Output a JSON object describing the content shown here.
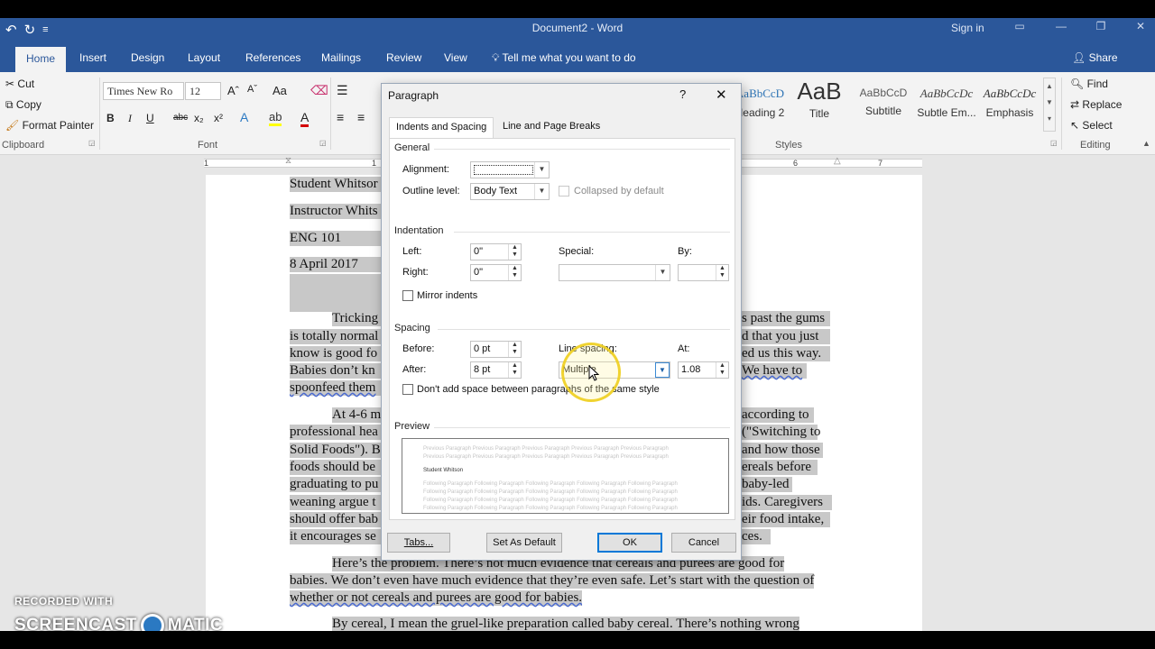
{
  "window": {
    "title": "Document2 - Word",
    "sign_in": "Sign in",
    "share": "Share",
    "qat_undo": "↶",
    "qat_redo": "↻",
    "qat_more": "≡"
  },
  "ribbon_tabs": [
    "Home",
    "Insert",
    "Design",
    "Layout",
    "References",
    "Mailings",
    "Review",
    "View"
  ],
  "tell_me": "Tell me what you want to do",
  "clipboard": {
    "cut": "Cut",
    "copy": "Copy",
    "format_painter": "Format Painter",
    "label": "Clipboard"
  },
  "font": {
    "name": "Times New Ro",
    "size": "12",
    "label": "Font",
    "bold": "B",
    "italic": "I",
    "underline": "U",
    "strike": "abc",
    "subscript": "x₂",
    "superscript": "x²",
    "grow": "Aˆ",
    "shrink": "Aˇ",
    "change_case": "Aa"
  },
  "styles": {
    "label": "Styles",
    "items": [
      {
        "sample": "AaBbCcD",
        "name": "Heading 2"
      },
      {
        "sample": "AaB",
        "name": "Title"
      },
      {
        "sample": "AaBbCcD",
        "name": "Subtitle"
      },
      {
        "sample": "AaBbCcDc",
        "name": "Subtle Em..."
      },
      {
        "sample": "AaBbCcDc",
        "name": "Emphasis"
      }
    ]
  },
  "editing": {
    "find": "Find",
    "replace": "Replace",
    "select": "Select",
    "label": "Editing"
  },
  "ruler_numbers": [
    "1",
    "1",
    "6",
    "7"
  ],
  "document": {
    "lines": [
      "Student Whitsor",
      "Instructor Whits",
      "ENG 101",
      "8 April 2017"
    ],
    "para1_left": [
      "Tricking",
      "is totally normal",
      "know is good fo",
      "Babies don’t kn",
      "spoonfeed them"
    ],
    "para1_right": [
      "s past the gums",
      "d that you just",
      "ed us this way.",
      "We have to"
    ],
    "para2_left": [
      "At 4-6 m",
      "professional hea",
      "Solid Foods\"). B",
      "foods should be",
      "graduating to pu",
      "weaning argue t",
      "should offer bab",
      "it encourages se"
    ],
    "para2_right": [
      "according to",
      "(\"Switching to",
      "and how those",
      "ereals before",
      "baby-led",
      "ids. Caregivers",
      "eir food intake,",
      "ces."
    ],
    "para3": [
      "Here’s the problem. There’s not much evidence that cereals and purees are good for",
      "babies. We don’t even have much evidence that they’re even safe. Let’s start with the question of",
      "whether or not cereals and purees are good for babies."
    ],
    "para4": "By cereal, I mean the gruel-like preparation called baby cereal. There’s nothing wrong"
  },
  "dialog": {
    "title": "Paragraph",
    "help": "?",
    "close": "✕",
    "tabs": [
      "Indents and Spacing",
      "Line and Page Breaks"
    ],
    "general": {
      "heading": "General",
      "alignment_label": "Alignment:",
      "alignment_value": "",
      "outline_label": "Outline level:",
      "outline_value": "Body Text",
      "collapsed_label": "Collapsed by default"
    },
    "indentation": {
      "heading": "Indentation",
      "left_label": "Left:",
      "left_value": "0\"",
      "right_label": "Right:",
      "right_value": "0\"",
      "special_label": "Special:",
      "special_value": "",
      "by_label": "By:",
      "by_value": "",
      "mirror_label": "Mirror indents"
    },
    "spacing": {
      "heading": "Spacing",
      "before_label": "Before:",
      "before_value": "0 pt",
      "after_label": "After:",
      "after_value": "8 pt",
      "line_spacing_label": "Line spacing:",
      "line_spacing_value": "Multiple",
      "at_label": "At:",
      "at_value": "1.08",
      "dont_add_label": "Don't add space between paragraphs of the same style"
    },
    "preview": {
      "heading": "Preview",
      "prev_text": "Previous Paragraph Previous Paragraph Previous Paragraph Previous Paragraph Previous Paragraph",
      "sample": "Student Whitson",
      "follow_text": "Following Paragraph Following Paragraph Following Paragraph Following Paragraph Following Paragraph"
    },
    "buttons": {
      "tabs": "Tabs...",
      "set_default": "Set As Default",
      "ok": "OK",
      "cancel": "Cancel"
    }
  },
  "watermark": {
    "line1": "RECORDED WITH",
    "brand_left": "SCREENCAST",
    "brand_right": "MATIC"
  },
  "colors": {
    "word_blue": "#2b579a",
    "ribbon_bg": "#f3f3f3",
    "highlight": "#c8c8c8",
    "cursor_ring": "#eece1e"
  }
}
